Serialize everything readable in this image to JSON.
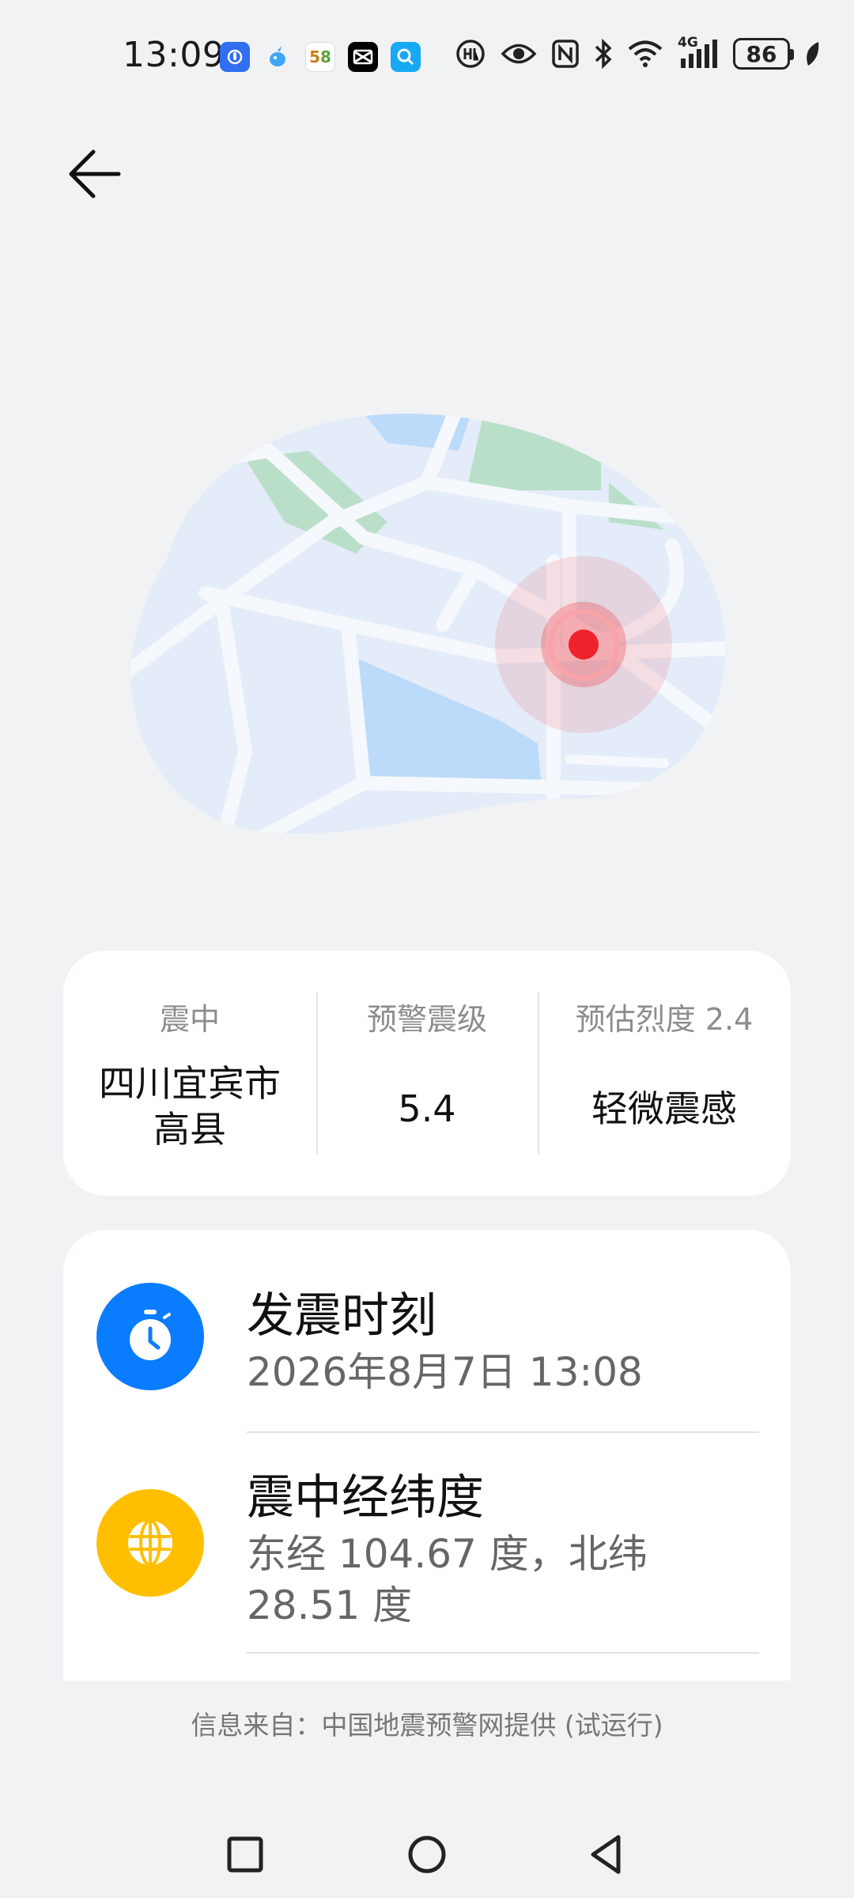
{
  "status_bar": {
    "time": "13:09",
    "battery": "86",
    "app_icons": [
      "finger-app-icon",
      "bird-app-icon",
      "58-app-icon",
      "capcut-app-icon",
      "search-app-icon"
    ],
    "app_58_label": "58",
    "sys_icons": [
      "hd-call-icon",
      "eye-icon",
      "nfc-icon",
      "bluetooth-icon",
      "wifi-icon",
      "4g-signal-icon",
      "battery-icon",
      "leaf-icon"
    ],
    "network_label": "4G"
  },
  "summary": {
    "epicenter_label": "震中",
    "epicenter_value_line1": "四川宜宾市",
    "epicenter_value_line2": "高县",
    "magnitude_label": "预警震级",
    "magnitude_value": "5.4",
    "intensity_label": "预估烈度 2.4",
    "intensity_value": "轻微震感"
  },
  "details": {
    "time_title": "发震时刻",
    "time_value": "2026年8月7日 13:08",
    "coords_title": "震中经纬度",
    "coords_value": "东经 104.67 度，北纬 28.51 度"
  },
  "footer": {
    "source": "信息来自：中国地震预警网提供 (试运行)"
  },
  "colors": {
    "clock_icon_bg": "#0a7cff",
    "globe_icon_bg": "#ffbf00",
    "epicenter_red": "#f0222c",
    "map_land": "#e3ecf8",
    "map_water": "#bcdaf9",
    "map_park": "#b9dfc8"
  }
}
